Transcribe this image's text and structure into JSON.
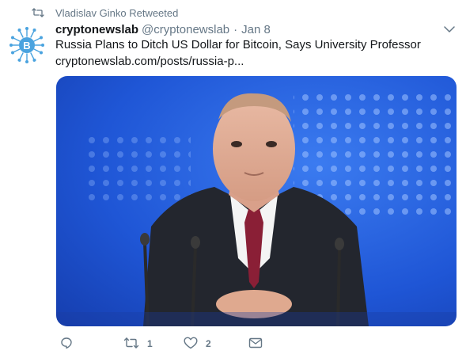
{
  "retweet_context": {
    "icon": "retweet-icon",
    "text": "Vladislav Ginko Retweeted"
  },
  "tweet": {
    "avatar_icon": "bitcoin-circuit-logo",
    "display_name": "cryptonewslab",
    "handle": "@cryptonewslab",
    "separator": "·",
    "time": "Jan 8",
    "text": "Russia Plans to Ditch US Dollar for Bitcoin, Says University Professor",
    "link": "cryptonewslab.com/posts/russia-p...",
    "media_alt": "man-in-suit-at-press-conference-photo"
  },
  "actions": {
    "reply": {
      "icon": "reply-icon",
      "count": ""
    },
    "retweet": {
      "icon": "retweet-icon",
      "count": "1"
    },
    "like": {
      "icon": "heart-icon",
      "count": "2"
    },
    "dm": {
      "icon": "envelope-icon",
      "count": ""
    }
  },
  "colors": {
    "text_primary": "#14171a",
    "text_secondary": "#657786",
    "logo_blue": "#4aa3df",
    "background": "#ffffff"
  }
}
